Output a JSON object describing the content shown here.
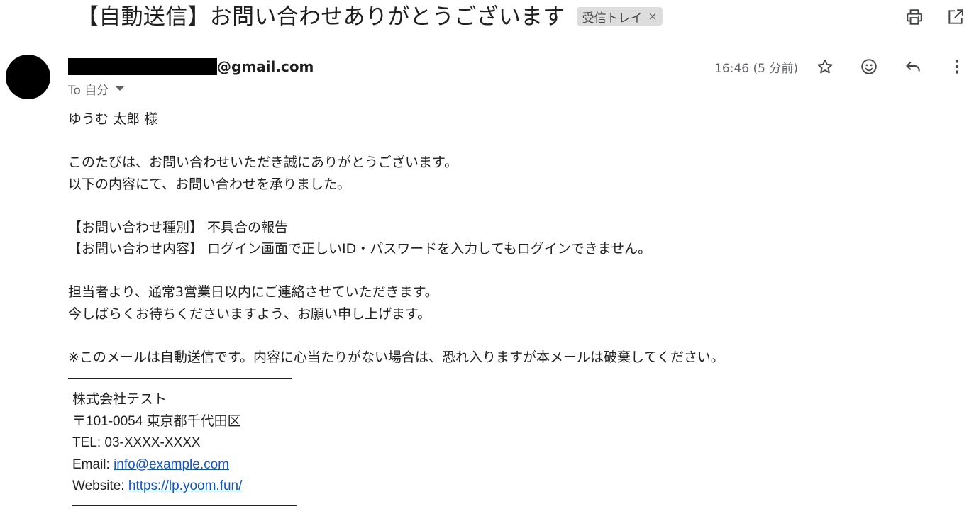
{
  "subject": {
    "title": "【自動送信】お問い合わせありがとうございます",
    "label": "受信トレイ",
    "label_close": "×"
  },
  "top_actions": {
    "print_icon": "printer-icon",
    "open_new_window_icon": "open-in-new-icon"
  },
  "sender": {
    "email_domain": "@gmail.com",
    "recipient": "To 自分",
    "timestamp": "16:46 (5 分前)"
  },
  "message_actions": {
    "star_icon": "star-icon",
    "emoji_icon": "emoji-icon",
    "reply_icon": "reply-icon",
    "more_icon": "more-vert-icon"
  },
  "body": {
    "greeting": "ゆうむ 太郎 様",
    "para1_line1": "このたびは、お問い合わせいただき誠にありがとうございます。",
    "para1_line2": "以下の内容にて、お問い合わせを承りました。",
    "field1": "【お問い合わせ種別】 不具合の報告",
    "field2": "【お問い合わせ内容】 ログイン画面で正しいID・パスワードを入力してもログインできません。",
    "para2_line1": "担当者より、通常3営業日以内にご連絡させていただきます。",
    "para2_line2": "今しばらくお待ちくださいますよう、お願い申し上げます。",
    "notice": "※このメールは自動送信です。内容に心当たりがない場合は、恐れ入りますが本メールは破棄してください。"
  },
  "signature": {
    "company": "株式会社テスト",
    "address": "〒101-0054 東京都千代田区",
    "tel": "TEL: 03-XXXX-XXXX",
    "email_label": "Email: ",
    "email_link": "info@example.com",
    "website_label": "Website: ",
    "website_link": "https://lp.yoom.fun/"
  },
  "colors": {
    "link": "#1155cc",
    "chip_bg": "#dddddd",
    "muted_text": "#5f6368"
  }
}
